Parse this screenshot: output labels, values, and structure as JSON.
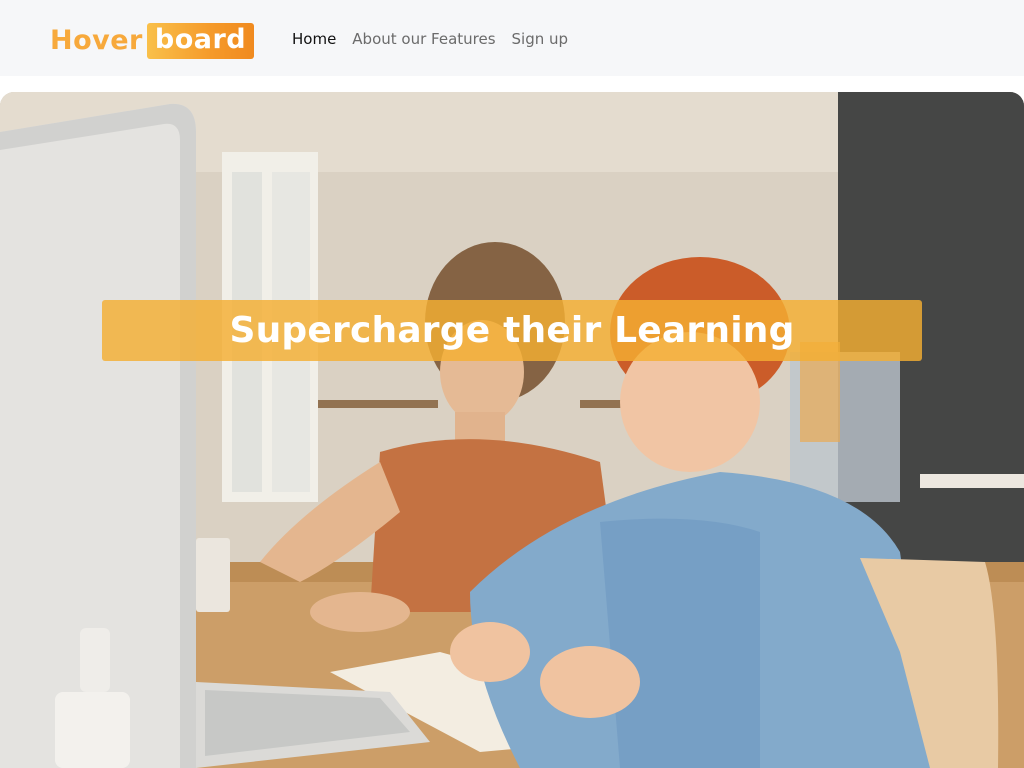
{
  "logo": {
    "part1": "Hover",
    "part2": "board"
  },
  "nav": {
    "items": [
      {
        "label": "Home",
        "active": true
      },
      {
        "label": "About our Features",
        "active": false
      },
      {
        "label": "Sign up",
        "active": false
      }
    ]
  },
  "hero": {
    "headline": "Supercharge their Learning",
    "accent_color": "#f4ae32"
  }
}
